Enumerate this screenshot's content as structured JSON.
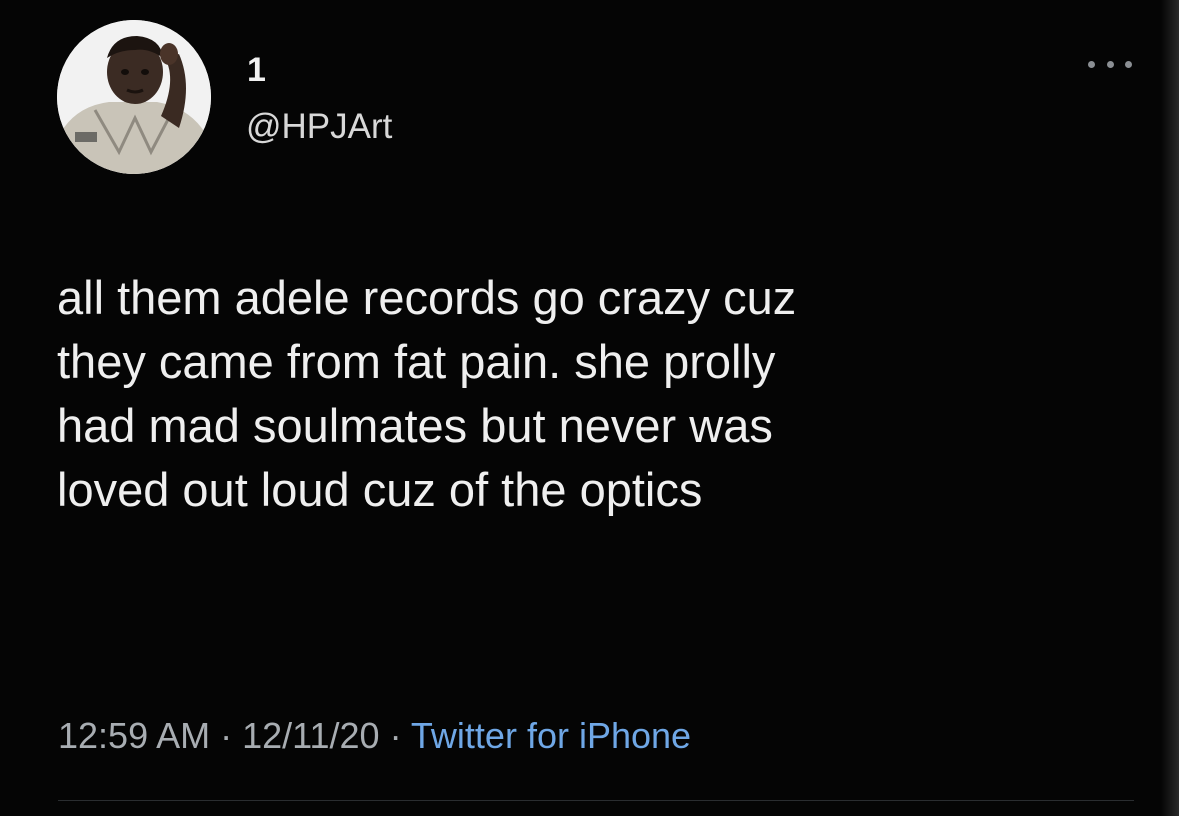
{
  "tweet": {
    "display_name": "1",
    "handle": "@HPJArt",
    "text_lines": [
      "all them adele records go crazy cuz",
      "they came from fat pain. she prolly",
      "had mad soulmates but never was",
      "loved out loud cuz of the optics"
    ],
    "time": "12:59 AM",
    "date": "12/11/20",
    "separator": " · ",
    "source": "Twitter for iPhone"
  },
  "colors": {
    "background": "#050505",
    "text": "#efefef",
    "secondary_text": "#a8adb2",
    "link": "#6fa7e6"
  },
  "icons": {
    "more": "more-horizontal-icon",
    "avatar": "profile-avatar"
  }
}
